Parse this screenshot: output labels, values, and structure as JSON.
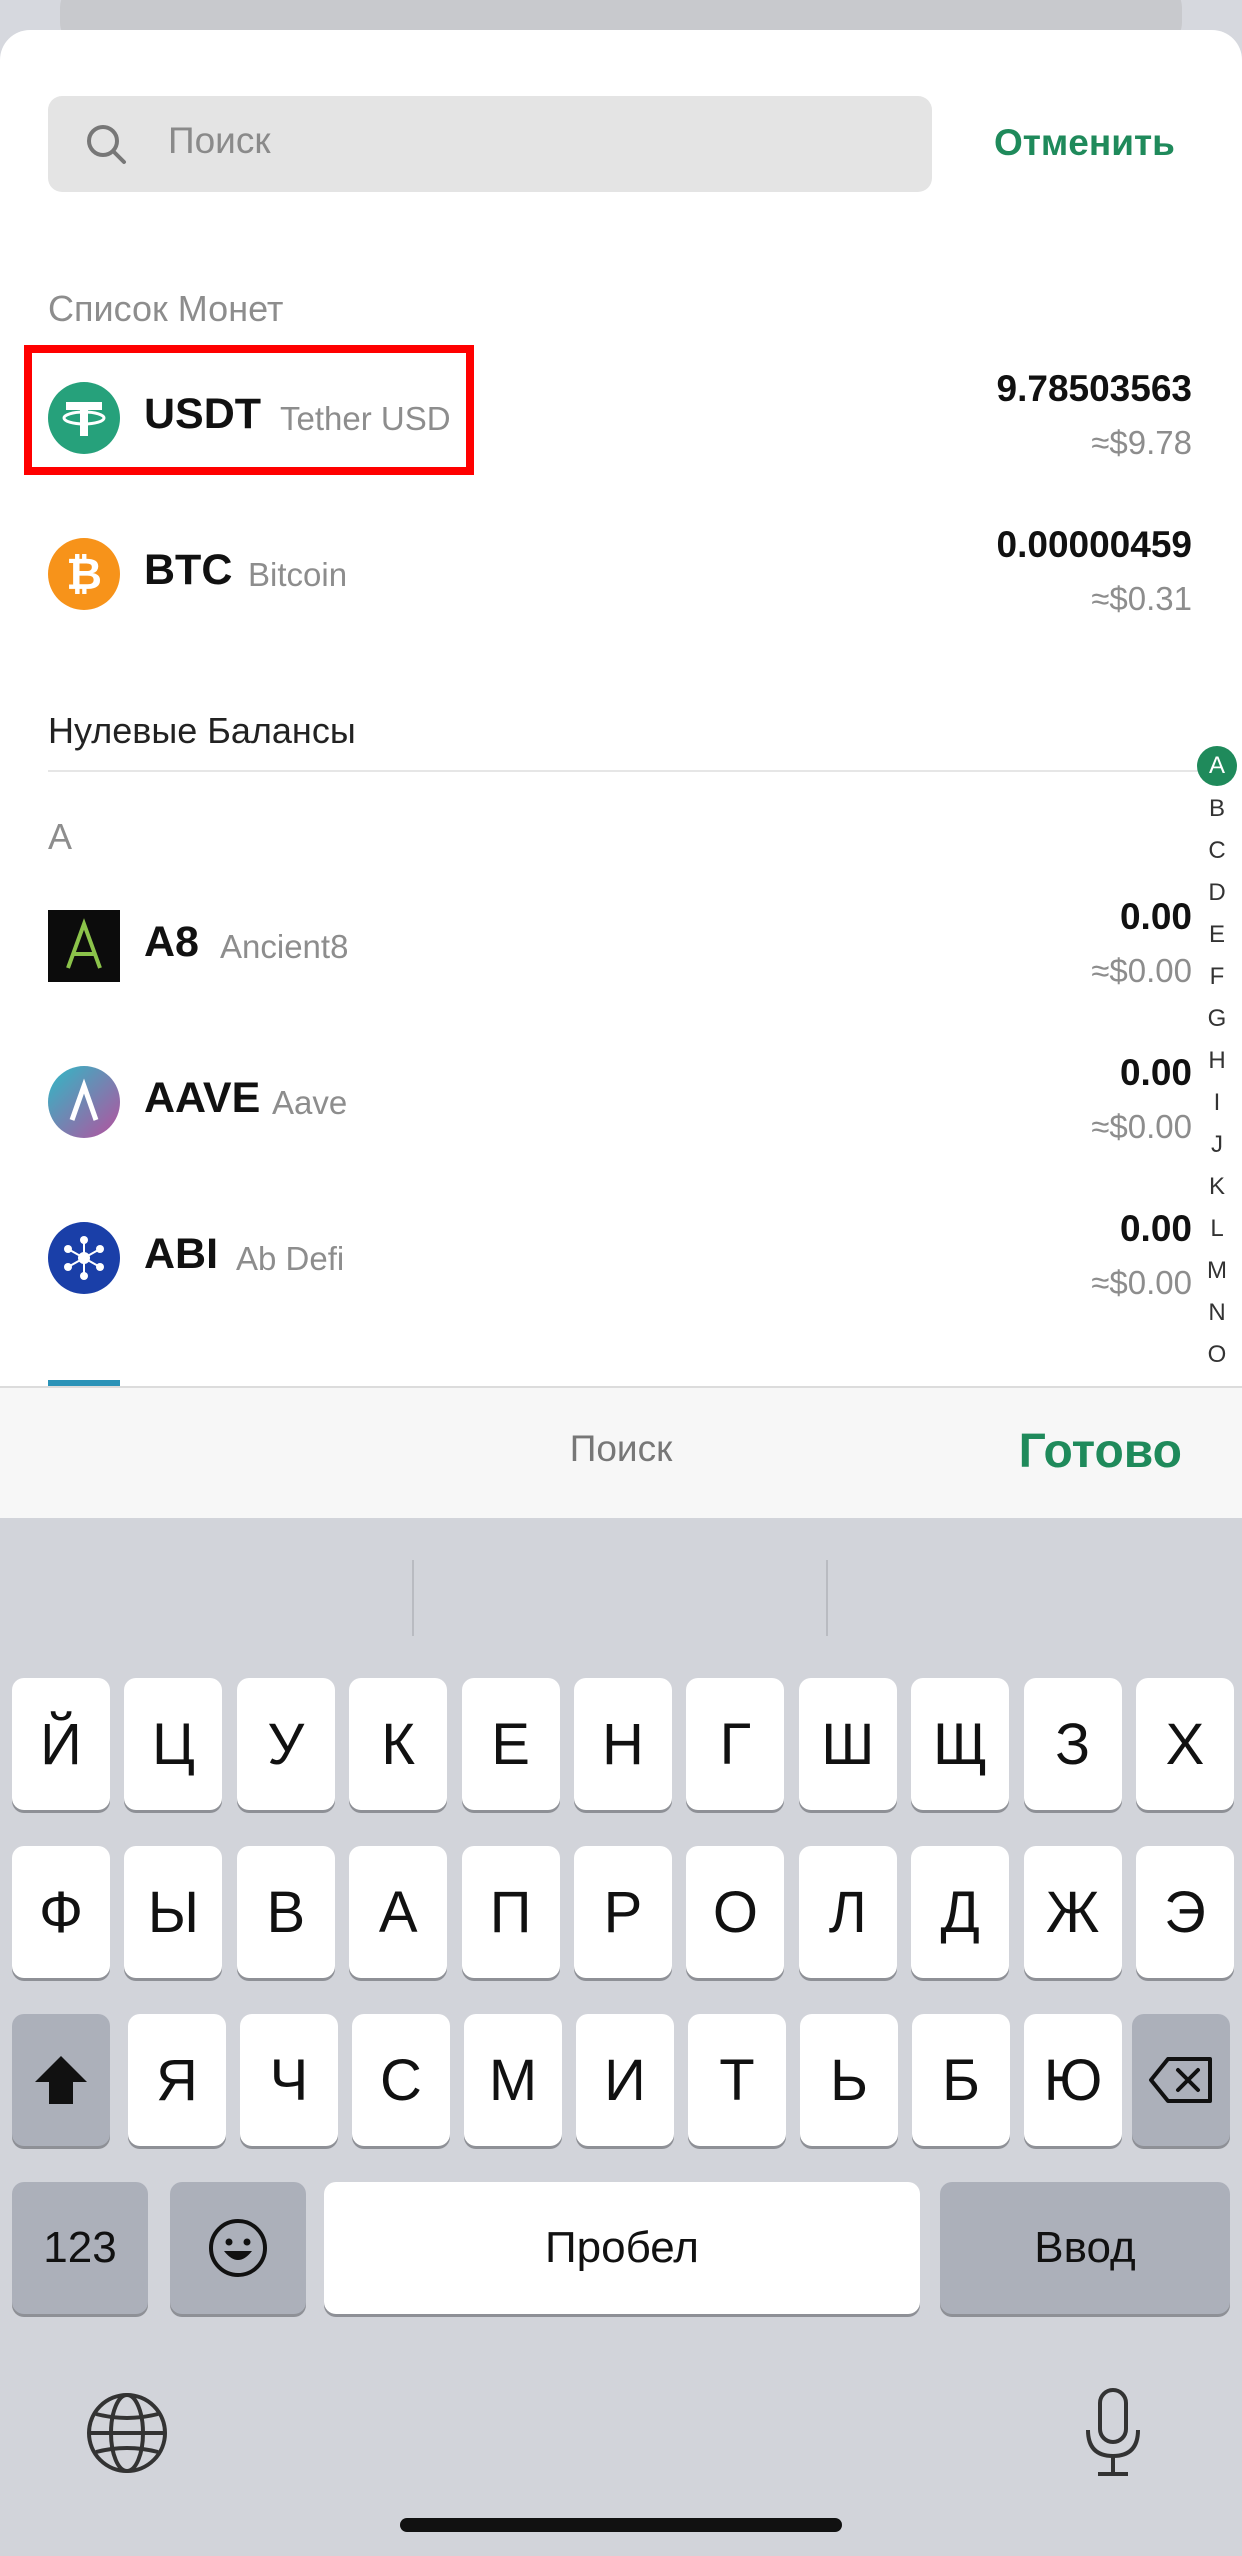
{
  "search": {
    "placeholder": "Поиск",
    "cancel_label": "Отменить"
  },
  "sections": {
    "coin_list": "Список Монет",
    "zero_balances": "Нулевые Балансы",
    "letter_a": "A"
  },
  "coins": [
    {
      "symbol": "USDT",
      "name": "Tether USD",
      "amount": "9.78503563",
      "fiat": "≈$9.78",
      "icon": "tether-icon",
      "color": "#26a17b"
    },
    {
      "symbol": "BTC",
      "name": "Bitcoin",
      "amount": "0.00000459",
      "fiat": "≈$0.31",
      "icon": "bitcoin-icon",
      "color": "#f7931a"
    }
  ],
  "zero_coins": [
    {
      "symbol": "A8",
      "name": "Ancient8",
      "amount": "0.00",
      "fiat": "≈$0.00",
      "icon": "ancient8-icon"
    },
    {
      "symbol": "AAVE",
      "name": "Aave",
      "amount": "0.00",
      "fiat": "≈$0.00",
      "icon": "aave-icon"
    },
    {
      "symbol": "ABI",
      "name": "Ab Defi",
      "amount": "0.00",
      "fiat": "≈$0.00",
      "icon": "abdefi-icon"
    }
  ],
  "alphabet_index": [
    "A",
    "B",
    "C",
    "D",
    "E",
    "F",
    "G",
    "H",
    "I",
    "J",
    "K",
    "L",
    "M",
    "N",
    "O"
  ],
  "accessory": {
    "center_label": "Поиск",
    "done_label": "Готово"
  },
  "keyboard": {
    "row1": [
      "Й",
      "Ц",
      "У",
      "К",
      "Е",
      "Н",
      "Г",
      "Ш",
      "Щ",
      "З",
      "Х"
    ],
    "row2": [
      "Ф",
      "Ы",
      "В",
      "А",
      "П",
      "Р",
      "О",
      "Л",
      "Д",
      "Ж",
      "Э"
    ],
    "row3": [
      "Я",
      "Ч",
      "С",
      "М",
      "И",
      "Т",
      "Ь",
      "Б",
      "Ю"
    ],
    "numbers_label": "123",
    "space_label": "Пробел",
    "return_label": "Ввод"
  },
  "colors": {
    "accent": "#1f8a5b",
    "highlight": "#ff0000"
  }
}
